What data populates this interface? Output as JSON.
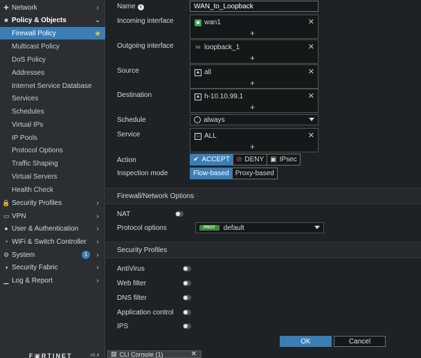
{
  "sidebar": {
    "items": [
      {
        "label": "Network",
        "icon": "network-icon",
        "glyph": "✚",
        "level": "top",
        "chevron": "›"
      },
      {
        "label": "Policy & Objects",
        "icon": "policy-objects-icon",
        "glyph": "■",
        "level": "top",
        "chevron": "⌄",
        "bold": true
      },
      {
        "label": "Firewall Policy",
        "level": "sub",
        "active": true,
        "star": "★"
      },
      {
        "label": "Multicast Policy",
        "level": "sub"
      },
      {
        "label": "DoS Policy",
        "level": "sub"
      },
      {
        "label": "Addresses",
        "level": "sub"
      },
      {
        "label": "Internet Service Database",
        "level": "sub"
      },
      {
        "label": "Services",
        "level": "sub"
      },
      {
        "label": "Schedules",
        "level": "sub"
      },
      {
        "label": "Virtual IPs",
        "level": "sub"
      },
      {
        "label": "IP Pools",
        "level": "sub"
      },
      {
        "label": "Protocol Options",
        "level": "sub"
      },
      {
        "label": "Traffic Shaping",
        "level": "sub"
      },
      {
        "label": "Virtual Servers",
        "level": "sub"
      },
      {
        "label": "Health Check",
        "level": "sub"
      },
      {
        "label": "Security Profiles",
        "icon": "lock-icon",
        "glyph": "🔒",
        "level": "top",
        "chevron": "›"
      },
      {
        "label": "VPN",
        "icon": "monitor-icon",
        "glyph": "▭",
        "level": "top",
        "chevron": "›"
      },
      {
        "label": "User & Authentication",
        "icon": "user-icon",
        "glyph": "●",
        "level": "top",
        "chevron": "›"
      },
      {
        "label": "WiFi & Switch Controller",
        "icon": "wifi-icon",
        "glyph": "◔",
        "level": "top",
        "chevron": "›"
      },
      {
        "label": "System",
        "icon": "gear-icon",
        "glyph": "⚙",
        "level": "top",
        "chevron": "›",
        "badge": "1"
      },
      {
        "label": "Security Fabric",
        "icon": "fabric-icon",
        "glyph": "◑",
        "level": "top",
        "chevron": "›"
      },
      {
        "label": "Log & Report",
        "icon": "chart-icon",
        "glyph": "▁",
        "level": "top",
        "chevron": "›"
      }
    ],
    "logo": "F▣RTINET",
    "version": "v6.4"
  },
  "form": {
    "name_label": "Name",
    "name_value": "WAN_to_Loopback",
    "incoming_label": "Incoming interface",
    "incoming_value": "wan1",
    "outgoing_label": "Outgoing interface",
    "outgoing_value": "loopback_1",
    "source_label": "Source",
    "source_value": "all",
    "destination_label": "Destination",
    "destination_value": "h-10.10.99.1",
    "schedule_label": "Schedule",
    "schedule_value": "always",
    "service_label": "Service",
    "service_value": "ALL",
    "action_label": "Action",
    "action_accept": "ACCEPT",
    "action_deny": "DENY",
    "action_ipsec": "IPsec",
    "inspection_label": "Inspection mode",
    "inspection_flow": "Flow-based",
    "inspection_proxy": "Proxy-based",
    "remove_glyph": "✕",
    "add_glyph": "+"
  },
  "firewall_network": {
    "header": "Firewall/Network Options",
    "nat_label": "NAT",
    "protocol_label": "Protocol options",
    "protocol_tag": "PROT",
    "protocol_value": "default"
  },
  "security_profiles": {
    "header": "Security Profiles",
    "antivirus_label": "AntiVirus",
    "webfilter_label": "Web filter",
    "dnsfilter_label": "DNS filter",
    "appcontrol_label": "Application control",
    "ips_label": "IPS"
  },
  "footer": {
    "ok_label": "OK",
    "cancel_label": "Cancel",
    "cli_label": "CLI Console (1)",
    "cli_close": "✕"
  },
  "colors": {
    "accent": "#3b7eb6",
    "sidebar_bg": "#2b2f33",
    "main_bg": "#1e2226",
    "star": "#f1c232"
  }
}
